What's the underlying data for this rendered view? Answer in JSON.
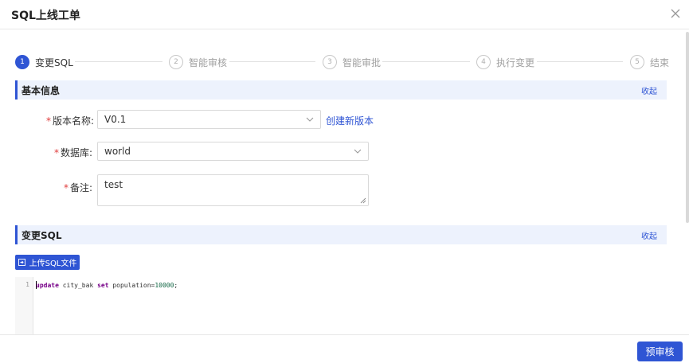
{
  "dialog": {
    "title": "SQL上线工单",
    "close_icon": "close-icon"
  },
  "steps": [
    {
      "num": "1",
      "label": "变更SQL",
      "active": true
    },
    {
      "num": "2",
      "label": "智能审核",
      "active": false
    },
    {
      "num": "3",
      "label": "智能审批",
      "active": false
    },
    {
      "num": "4",
      "label": "执行变更",
      "active": false
    },
    {
      "num": "5",
      "label": "结束",
      "active": false
    }
  ],
  "basic_info": {
    "title": "基本信息",
    "collapse_label": "收起",
    "version_label": "版本名称:",
    "version_value": "V0.1",
    "create_version_link": "创建新版本",
    "database_label": "数据库:",
    "database_value": "world",
    "remark_label": "备注:",
    "remark_value": "test"
  },
  "change_sql": {
    "title": "变更SQL",
    "collapse_label": "收起",
    "upload_label": "上传SQL文件",
    "upload_icon": "upload-file-icon",
    "line_number": "1",
    "code": {
      "kw1": "update",
      "table": " city_bak ",
      "kw2": "set",
      "assign": " population=",
      "value": "10000",
      "end": ";"
    }
  },
  "footer": {
    "submit_label": "预审核"
  },
  "colors": {
    "primary": "#2f55d4",
    "required": "#e03c3c",
    "section_bg": "#edf2fd"
  }
}
